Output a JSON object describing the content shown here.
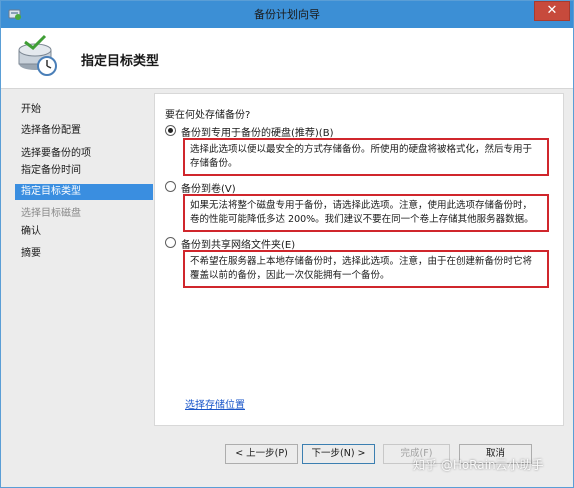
{
  "window": {
    "title": "备份计划向导"
  },
  "header": {
    "title": "指定目标类型"
  },
  "sidebar": {
    "steps": [
      {
        "label": "开始",
        "state": "normal"
      },
      {
        "label": "选择备份配置",
        "state": "normal"
      },
      {
        "label": "选择要备份的项",
        "state": "normal"
      },
      {
        "label": "指定备份时间",
        "state": "normal"
      },
      {
        "label": "指定目标类型",
        "state": "active"
      },
      {
        "label": "选择目标磁盘",
        "state": "disabled"
      },
      {
        "label": "确认",
        "state": "normal"
      },
      {
        "label": "摘要",
        "state": "normal"
      }
    ]
  },
  "main": {
    "question": "要在何处存储备份?",
    "options": [
      {
        "label": "备份到专用于备份的硬盘(推荐)(B)",
        "selected": true,
        "desc1": "选择此选项以便以最安全的方式存储备份。所使用的硬盘将被格式化，然后专用于",
        "desc2": "存储备份。"
      },
      {
        "label": "备份到卷(V)",
        "selected": false,
        "desc1": "如果无法将整个磁盘专用于备份，请选择此选项。注意，使用此选项存储备份时，",
        "desc2": "卷的性能可能降低多达 200%。我们建议不要在同一个卷上存储其他服务器数据。"
      },
      {
        "label": "备份到共享网络文件夹(E)",
        "selected": false,
        "desc1": "不希望在服务器上本地存储备份时，选择此选项。注意，由于在创建新备份时它将",
        "desc2": "覆盖以前的备份，因此一次仅能拥有一个备份。"
      }
    ],
    "link": "选择存储位置"
  },
  "buttons": {
    "prev": "< 上一步(P)",
    "next": "下一步(N) >",
    "finish": "完成(F)",
    "cancel": "取消"
  },
  "watermark": "知乎 @HoRain云小助手",
  "colors": {
    "titlebar": "#3c8fd5",
    "active_step": "#3a8ee0",
    "highlight_border": "#d0262c",
    "link": "#1a56c9"
  }
}
